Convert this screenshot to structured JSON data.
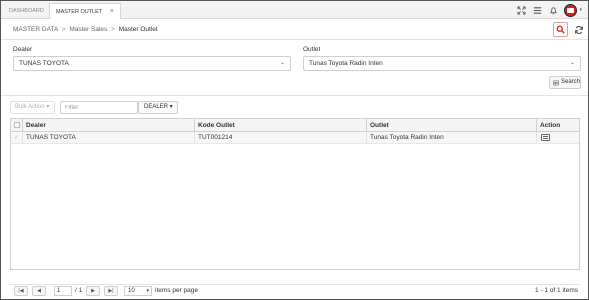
{
  "tabs": {
    "dashboard": "DASHBOARD",
    "master_outlet": "MASTER OUTLET",
    "close": "×"
  },
  "icons": {
    "expand": "expand-icon",
    "menu": "menu-icon",
    "notifications": "bell-icon",
    "avatar": "avatar-icon",
    "search": "search-icon",
    "refresh": "refresh-icon",
    "action": "list-icon"
  },
  "breadcrumb": {
    "level1": "MASTER DATA",
    "level2": "Master Sales",
    "current": "Master Outlet",
    "separator": ">"
  },
  "filters": {
    "dealer_label": "Dealer",
    "dealer_value": "TUNAS TOYOTA",
    "outlet_label": "Outlet",
    "outlet_value": "Tunas Toyota Radin Inten",
    "search_button": "Search",
    "caret": "⌄"
  },
  "toolbar": {
    "bulk_action": "Bulk Action ▾",
    "filter_placeholder": "Filter",
    "dealer_dropdown": "DEALER ▾"
  },
  "grid": {
    "columns": [
      "Dealer",
      "Kode Outlet",
      "Outlet",
      "Action"
    ],
    "rows": [
      {
        "dealer": "TUNAS TOYOTA",
        "kode": "TUT001214",
        "outlet": "Tunas Toyota Radin Inten"
      }
    ]
  },
  "pager": {
    "first": "|◀",
    "prev": "◀",
    "page": "1",
    "of": "/ 1",
    "next": "▶",
    "last": "▶|",
    "page_size": "10",
    "page_size_caret": "▾",
    "page_size_label": "items per page",
    "summary": "1 - 1 of 1 items"
  },
  "colors": {
    "accent": "#d62020",
    "border": "#cfcfcf"
  }
}
